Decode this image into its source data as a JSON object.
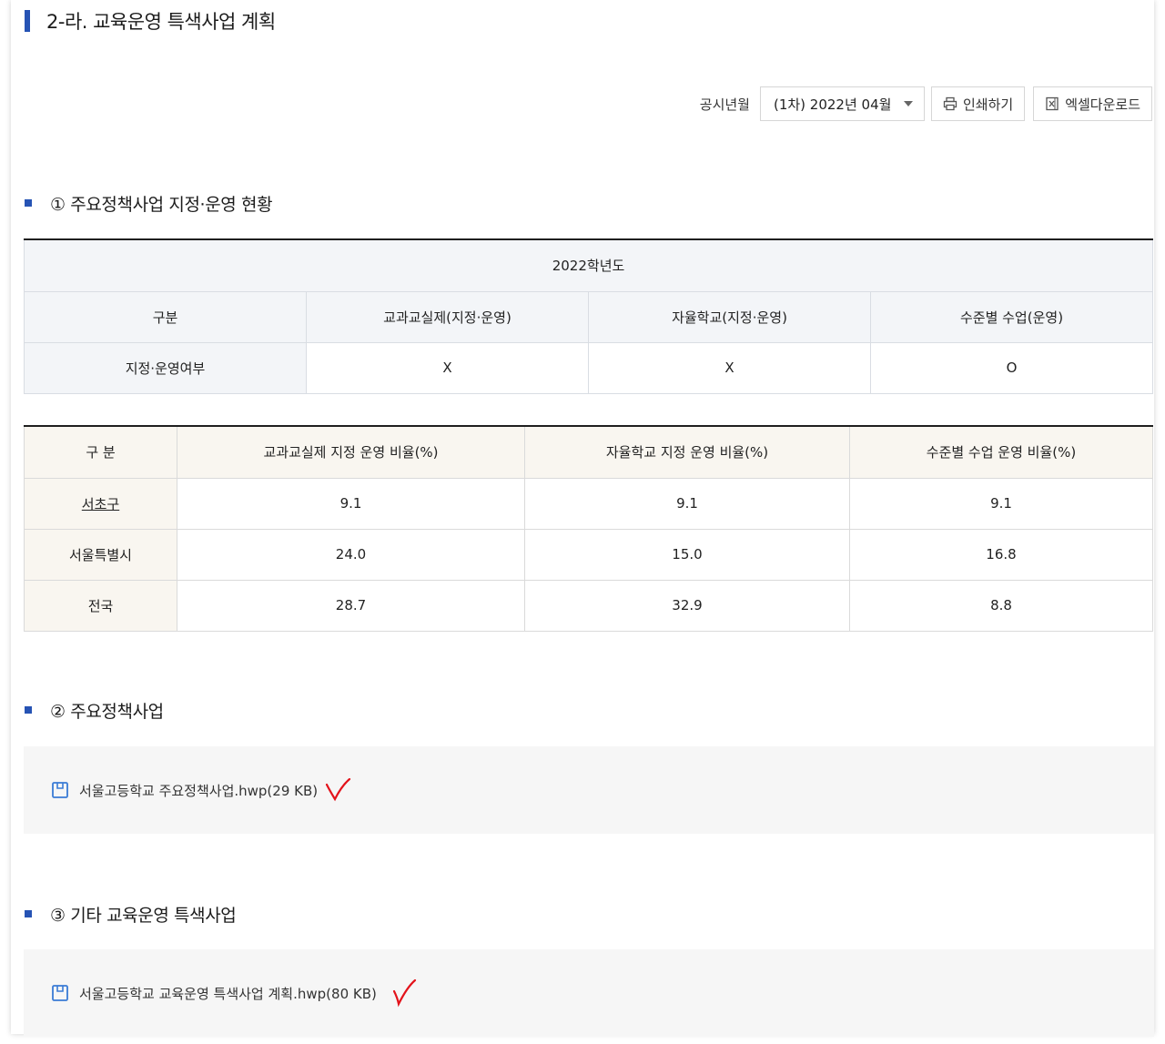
{
  "page_title": "2-라. 교육운영 특색사업 계획",
  "toolbar": {
    "period_label": "공시년월",
    "period_select": "(1차) 2022년 04월",
    "print_label": "인쇄하기",
    "excel_label": "엑셀다운로드"
  },
  "section1": {
    "title": "① 주요정책사업 지정·운영 현황",
    "table1": {
      "year": "2022학년도",
      "headers": [
        "구분",
        "교과교실제(지정·운영)",
        "자율학교(지정·운영)",
        "수준별 수업(운영)"
      ],
      "row_label": "지정·운영여부",
      "row_values": [
        "X",
        "X",
        "O"
      ]
    },
    "table2": {
      "headers": [
        "구 분",
        "교과교실제 지정 운영 비율(%)",
        "자율학교 지정 운영 비율(%)",
        "수준별 수업 운영 비율(%)"
      ],
      "rows": [
        {
          "label": "서초구",
          "values": [
            "9.1",
            "9.1",
            "9.1"
          ]
        },
        {
          "label": "서울특별시",
          "values": [
            "24.0",
            "15.0",
            "16.8"
          ]
        },
        {
          "label": "전국",
          "values": [
            "28.7",
            "32.9",
            "8.8"
          ]
        }
      ]
    }
  },
  "section2": {
    "title": "② 주요정책사업",
    "file": "서울고등학교 주요정책사업.hwp(29 KB)"
  },
  "section3": {
    "title": "③ 기타 교육운영 특색사업",
    "file": "서울고등학교 교육운영 특색사업 계획.hwp(80 KB)"
  },
  "colors": {
    "accent": "#2653b4",
    "check_mark": "#e3131b",
    "table1_header_bg": "#f3f5f8",
    "table2_header_bg": "#f9f6f0",
    "filebox_bg": "#f6f6f6"
  },
  "icons": [
    "printer-icon",
    "excel-icon",
    "file-download-icon",
    "checkmark-annotation"
  ]
}
